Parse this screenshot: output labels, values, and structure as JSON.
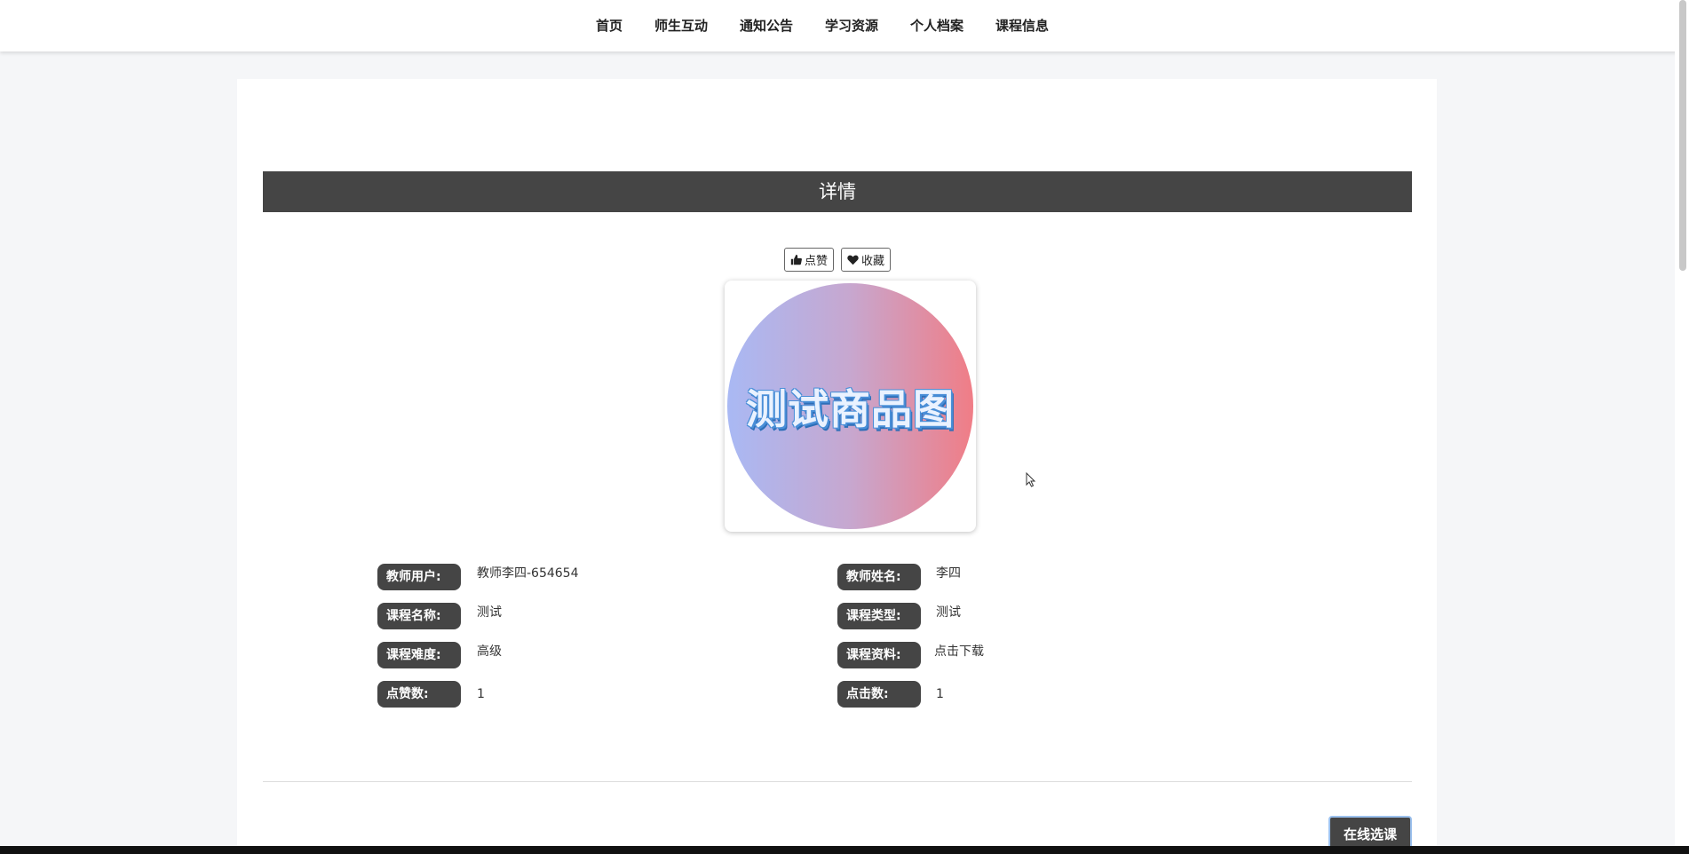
{
  "nav": {
    "items": [
      {
        "label": "首页"
      },
      {
        "label": "师生互动"
      },
      {
        "label": "通知公告"
      },
      {
        "label": "学习资源"
      },
      {
        "label": "个人档案"
      },
      {
        "label": "课程信息"
      }
    ]
  },
  "detail": {
    "title": "详情",
    "like_label": "点赞",
    "favorite_label": "收藏",
    "image_text": "测试商品图",
    "enroll_label": "在线选课"
  },
  "info": {
    "teacher_user_label": "教师用户:",
    "teacher_user_value": "教师李四-654654",
    "teacher_name_label": "教师姓名:",
    "teacher_name_value": "李四",
    "course_name_label": "课程名称:",
    "course_name_value": "测试",
    "course_type_label": "课程类型:",
    "course_type_value": "测试",
    "difficulty_label": "课程难度:",
    "difficulty_value": "高级",
    "material_label": "课程资料:",
    "material_value": "点击下载",
    "likes_label": "点赞数:",
    "likes_value": "1",
    "clicks_label": "点击数:",
    "clicks_value": "1"
  },
  "colors": {
    "dark_bar": "#454545",
    "enroll_border": "#9cc1ee",
    "page_bg": "#f5f6f8"
  }
}
